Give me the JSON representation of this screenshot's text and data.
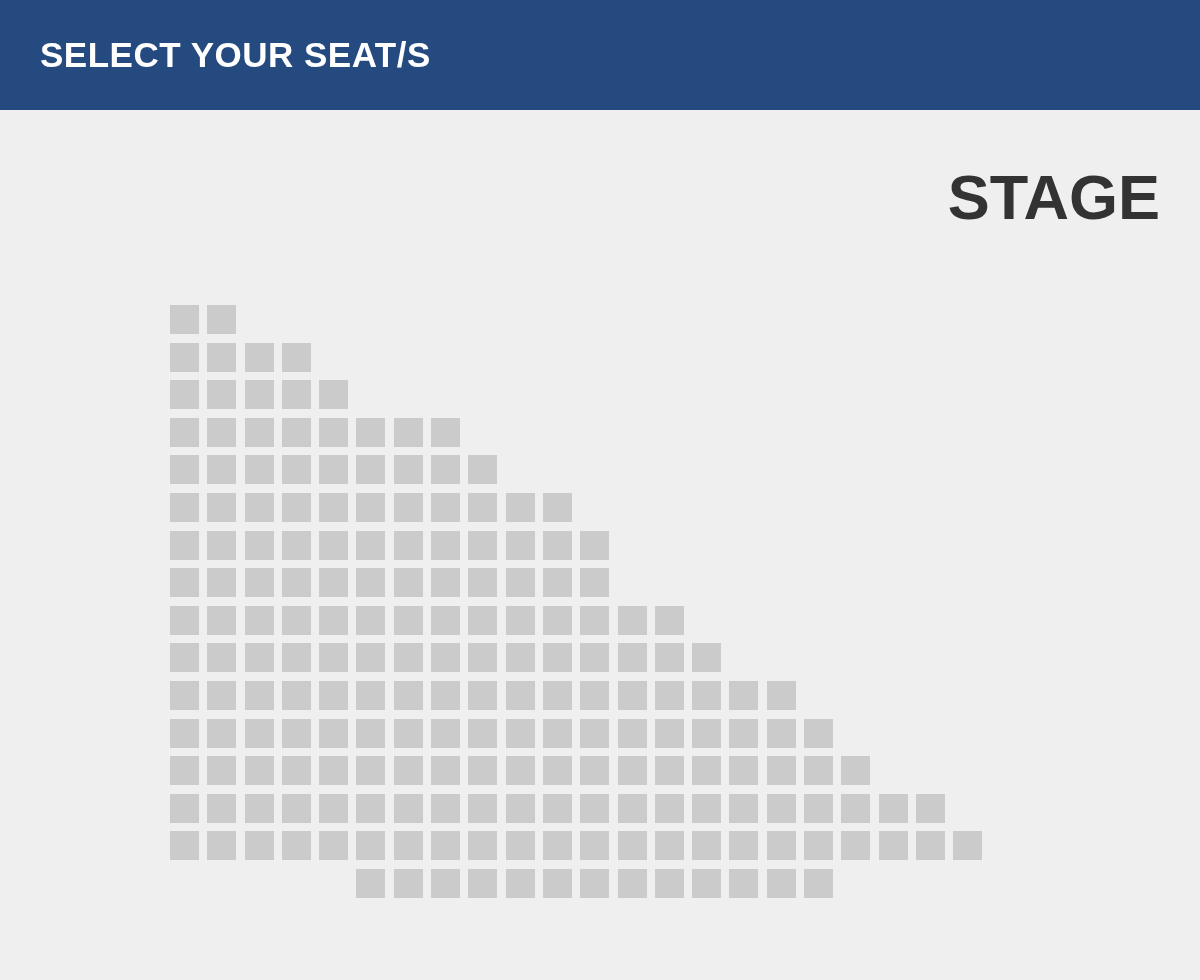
{
  "header": {
    "title": "SELECT YOUR SEAT/S"
  },
  "stage": {
    "label": "STAGE"
  },
  "seat_map": {
    "rows": [
      {
        "seats": [
          {
            "kind": "seat"
          },
          {
            "kind": "seat"
          }
        ]
      },
      {
        "seats": [
          {
            "kind": "seat"
          },
          {
            "kind": "seat"
          },
          {
            "kind": "seat"
          },
          {
            "kind": "seat"
          }
        ]
      },
      {
        "seats": [
          {
            "kind": "seat"
          },
          {
            "kind": "seat"
          },
          {
            "kind": "seat"
          },
          {
            "kind": "seat"
          },
          {
            "kind": "seat"
          }
        ]
      },
      {
        "seats": [
          {
            "kind": "seat"
          },
          {
            "kind": "seat"
          },
          {
            "kind": "seat"
          },
          {
            "kind": "seat"
          },
          {
            "kind": "seat"
          },
          {
            "kind": "seat"
          },
          {
            "kind": "seat"
          },
          {
            "kind": "seat"
          }
        ]
      },
      {
        "seats": [
          {
            "kind": "seat"
          },
          {
            "kind": "seat"
          },
          {
            "kind": "seat"
          },
          {
            "kind": "seat"
          },
          {
            "kind": "seat"
          },
          {
            "kind": "seat"
          },
          {
            "kind": "seat"
          },
          {
            "kind": "seat"
          },
          {
            "kind": "seat"
          }
        ]
      },
      {
        "seats": [
          {
            "kind": "seat"
          },
          {
            "kind": "seat"
          },
          {
            "kind": "seat"
          },
          {
            "kind": "seat"
          },
          {
            "kind": "seat"
          },
          {
            "kind": "seat"
          },
          {
            "kind": "seat"
          },
          {
            "kind": "seat"
          },
          {
            "kind": "seat"
          },
          {
            "kind": "seat"
          },
          {
            "kind": "seat"
          }
        ]
      },
      {
        "seats": [
          {
            "kind": "seat"
          },
          {
            "kind": "seat"
          },
          {
            "kind": "seat"
          },
          {
            "kind": "seat"
          },
          {
            "kind": "seat"
          },
          {
            "kind": "seat"
          },
          {
            "kind": "seat"
          },
          {
            "kind": "seat"
          },
          {
            "kind": "seat"
          },
          {
            "kind": "seat"
          },
          {
            "kind": "seat"
          },
          {
            "kind": "seat"
          }
        ]
      },
      {
        "seats": [
          {
            "kind": "seat"
          },
          {
            "kind": "seat"
          },
          {
            "kind": "seat"
          },
          {
            "kind": "seat"
          },
          {
            "kind": "seat"
          },
          {
            "kind": "seat"
          },
          {
            "kind": "seat"
          },
          {
            "kind": "seat"
          },
          {
            "kind": "seat"
          },
          {
            "kind": "seat"
          },
          {
            "kind": "seat"
          },
          {
            "kind": "seat"
          }
        ]
      },
      {
        "seats": [
          {
            "kind": "seat"
          },
          {
            "kind": "seat"
          },
          {
            "kind": "seat"
          },
          {
            "kind": "seat"
          },
          {
            "kind": "seat"
          },
          {
            "kind": "seat"
          },
          {
            "kind": "seat"
          },
          {
            "kind": "seat"
          },
          {
            "kind": "seat"
          },
          {
            "kind": "seat"
          },
          {
            "kind": "seat"
          },
          {
            "kind": "seat"
          },
          {
            "kind": "seat"
          },
          {
            "kind": "seat"
          }
        ]
      },
      {
        "seats": [
          {
            "kind": "seat"
          },
          {
            "kind": "seat"
          },
          {
            "kind": "seat"
          },
          {
            "kind": "seat"
          },
          {
            "kind": "seat"
          },
          {
            "kind": "seat"
          },
          {
            "kind": "seat"
          },
          {
            "kind": "seat"
          },
          {
            "kind": "seat"
          },
          {
            "kind": "seat"
          },
          {
            "kind": "seat"
          },
          {
            "kind": "seat"
          },
          {
            "kind": "seat"
          },
          {
            "kind": "seat"
          },
          {
            "kind": "seat"
          }
        ]
      },
      {
        "seats": [
          {
            "kind": "seat"
          },
          {
            "kind": "seat"
          },
          {
            "kind": "seat"
          },
          {
            "kind": "seat"
          },
          {
            "kind": "seat"
          },
          {
            "kind": "seat"
          },
          {
            "kind": "seat"
          },
          {
            "kind": "seat"
          },
          {
            "kind": "seat"
          },
          {
            "kind": "seat"
          },
          {
            "kind": "seat"
          },
          {
            "kind": "seat"
          },
          {
            "kind": "seat"
          },
          {
            "kind": "seat"
          },
          {
            "kind": "seat"
          },
          {
            "kind": "seat"
          },
          {
            "kind": "seat"
          }
        ]
      },
      {
        "seats": [
          {
            "kind": "seat"
          },
          {
            "kind": "seat"
          },
          {
            "kind": "seat"
          },
          {
            "kind": "seat"
          },
          {
            "kind": "seat"
          },
          {
            "kind": "seat"
          },
          {
            "kind": "seat"
          },
          {
            "kind": "seat"
          },
          {
            "kind": "seat"
          },
          {
            "kind": "seat"
          },
          {
            "kind": "seat"
          },
          {
            "kind": "seat"
          },
          {
            "kind": "seat"
          },
          {
            "kind": "seat"
          },
          {
            "kind": "seat"
          },
          {
            "kind": "seat"
          },
          {
            "kind": "seat"
          },
          {
            "kind": "seat"
          }
        ]
      },
      {
        "seats": [
          {
            "kind": "seat"
          },
          {
            "kind": "seat"
          },
          {
            "kind": "seat"
          },
          {
            "kind": "seat"
          },
          {
            "kind": "seat"
          },
          {
            "kind": "seat"
          },
          {
            "kind": "seat"
          },
          {
            "kind": "seat"
          },
          {
            "kind": "seat"
          },
          {
            "kind": "seat"
          },
          {
            "kind": "seat"
          },
          {
            "kind": "seat"
          },
          {
            "kind": "seat"
          },
          {
            "kind": "seat"
          },
          {
            "kind": "seat"
          },
          {
            "kind": "seat"
          },
          {
            "kind": "seat"
          },
          {
            "kind": "seat"
          },
          {
            "kind": "seat"
          }
        ]
      },
      {
        "seats": [
          {
            "kind": "seat"
          },
          {
            "kind": "seat"
          },
          {
            "kind": "seat"
          },
          {
            "kind": "seat"
          },
          {
            "kind": "seat"
          },
          {
            "kind": "seat"
          },
          {
            "kind": "seat"
          },
          {
            "kind": "seat"
          },
          {
            "kind": "seat"
          },
          {
            "kind": "seat"
          },
          {
            "kind": "seat"
          },
          {
            "kind": "seat"
          },
          {
            "kind": "seat"
          },
          {
            "kind": "seat"
          },
          {
            "kind": "seat"
          },
          {
            "kind": "seat"
          },
          {
            "kind": "seat"
          },
          {
            "kind": "seat"
          },
          {
            "kind": "seat"
          },
          {
            "kind": "seat"
          },
          {
            "kind": "seat"
          }
        ]
      },
      {
        "seats": [
          {
            "kind": "seat"
          },
          {
            "kind": "seat"
          },
          {
            "kind": "seat"
          },
          {
            "kind": "seat"
          },
          {
            "kind": "seat"
          },
          {
            "kind": "seat"
          },
          {
            "kind": "seat"
          },
          {
            "kind": "seat"
          },
          {
            "kind": "seat"
          },
          {
            "kind": "seat"
          },
          {
            "kind": "seat"
          },
          {
            "kind": "seat"
          },
          {
            "kind": "seat"
          },
          {
            "kind": "seat"
          },
          {
            "kind": "seat"
          },
          {
            "kind": "seat"
          },
          {
            "kind": "seat"
          },
          {
            "kind": "seat"
          },
          {
            "kind": "seat"
          },
          {
            "kind": "seat"
          },
          {
            "kind": "seat"
          },
          {
            "kind": "seat"
          }
        ]
      },
      {
        "seats": [
          {
            "kind": "gap"
          },
          {
            "kind": "gap"
          },
          {
            "kind": "gap"
          },
          {
            "kind": "gap"
          },
          {
            "kind": "gap"
          },
          {
            "kind": "seat"
          },
          {
            "kind": "seat"
          },
          {
            "kind": "seat"
          },
          {
            "kind": "seat"
          },
          {
            "kind": "seat"
          },
          {
            "kind": "seat"
          },
          {
            "kind": "seat"
          },
          {
            "kind": "seat"
          },
          {
            "kind": "seat"
          },
          {
            "kind": "seat"
          },
          {
            "kind": "seat"
          },
          {
            "kind": "seat"
          },
          {
            "kind": "seat"
          }
        ]
      }
    ]
  }
}
